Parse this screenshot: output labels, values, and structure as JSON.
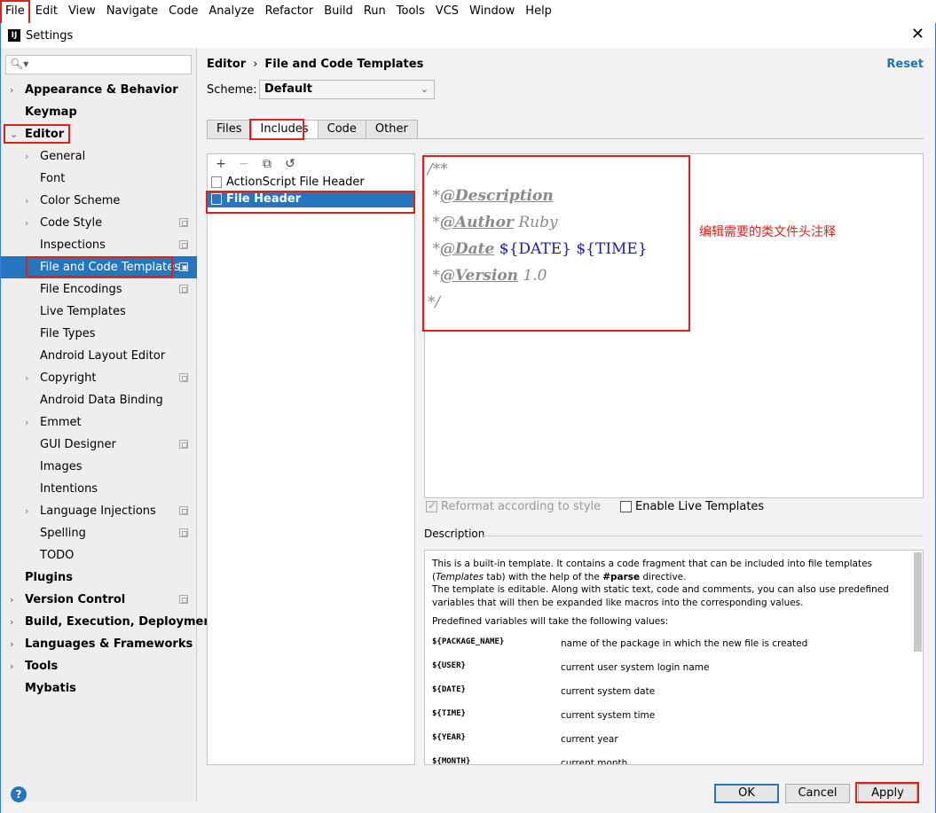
{
  "menubar": [
    "File",
    "Edit",
    "View",
    "Navigate",
    "Code",
    "Analyze",
    "Refactor",
    "Build",
    "Run",
    "Tools",
    "VCS",
    "Window",
    "Help"
  ],
  "window": {
    "title": "Settings"
  },
  "breadcrumb": {
    "parent": "Editor",
    "separator": "›",
    "current": "File and Code Templates"
  },
  "reset_label": "Reset",
  "scheme": {
    "label": "Scheme:",
    "value": "Default"
  },
  "tabs": [
    "Files",
    "Includes",
    "Code",
    "Other"
  ],
  "active_tab": "Includes",
  "tree": [
    "Appearance & Behavior",
    "Keymap",
    "Editor",
    "General",
    "Font",
    "Color Scheme",
    "Code Style",
    "Inspections",
    "File and Code Templates",
    "File Encodings",
    "Live Templates",
    "File Types",
    "Android Layout Editor",
    "Copyright",
    "Android Data Binding",
    "Emmet",
    "GUI Designer",
    "Images",
    "Intentions",
    "Language Injections",
    "Spelling",
    "TODO",
    "Plugins",
    "Version Control",
    "Build, Execution, Deployment",
    "Languages & Frameworks",
    "Tools",
    "Mybatis"
  ],
  "templates": [
    "ActionScript File Header",
    "File Header"
  ],
  "editor": {
    "open": "/**",
    "star": "*",
    "desc_tag": "@Description",
    "author_tag": "@Author",
    "author_val": "Ruby",
    "date_tag": "@Date",
    "date_var": "${DATE}",
    "time_var": "${TIME}",
    "version_tag": "@Version",
    "version_val": "1.0",
    "close": "*/"
  },
  "annotation": "编辑需要的类文件头注释",
  "options": {
    "reformat": "Reformat according to style",
    "live_templates": "Enable Live Templates"
  },
  "description": {
    "label": "Description",
    "p1a": "This is a built-in template. It contains a code fragment that can be included into file templates (",
    "p1b": "Templates",
    "p1c": " tab) with the help of the ",
    "p1d": "#parse",
    "p1e": " directive.",
    "p2": "The template is editable. Along with static text, code and comments, you can also use predefined variables that will then be expanded like macros into the corresponding values.",
    "p3": "Predefined variables will take the following values:",
    "vars": [
      {
        "name": "${PACKAGE_NAME}",
        "desc": "name of the package in which the new file is created"
      },
      {
        "name": "${USER}",
        "desc": "current user system login name"
      },
      {
        "name": "${DATE}",
        "desc": "current system date"
      },
      {
        "name": "${TIME}",
        "desc": "current system time"
      },
      {
        "name": "${YEAR}",
        "desc": "current year"
      },
      {
        "name": "${MONTH}",
        "desc": "current month"
      }
    ]
  },
  "buttons": {
    "ok": "OK",
    "cancel": "Cancel",
    "apply": "Apply"
  },
  "colors": {
    "accent": "#2675bf",
    "highlight": "#e0201a",
    "link": "#2470b3"
  }
}
